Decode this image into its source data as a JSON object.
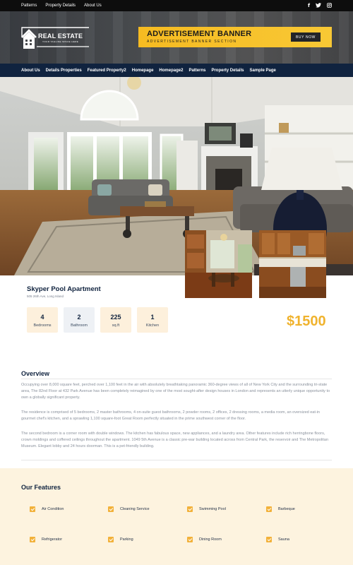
{
  "topbar": {
    "links": [
      "Patterns",
      "Property Details",
      "About Us"
    ],
    "social": [
      "facebook-icon",
      "twitter-icon",
      "instagram-icon"
    ]
  },
  "header": {
    "logo_title": "REAL ESTATE",
    "logo_tagline": "YOUR TAGLINE SPACE HERE",
    "ad_title": "ADVERTISEMENT BANNER",
    "ad_subtitle": "ADVERTISEMENT BANNER SECTION",
    "ad_button": "BUY NOW"
  },
  "nav": {
    "items": [
      "About Us",
      "Details Properties",
      "Featured Property2",
      "Homepage",
      "Homepage2",
      "Patterns",
      "Property Details",
      "Sample Page"
    ]
  },
  "property": {
    "title": "Skyper Pool Apartment",
    "address": "505 26th Ave, Long Island",
    "stats": [
      {
        "value": "4",
        "label": "Bedrooms"
      },
      {
        "value": "2",
        "label": "Bathroom"
      },
      {
        "value": "225",
        "label": "sq.ft"
      },
      {
        "value": "1",
        "label": "Kitchen"
      }
    ],
    "price": "$1500"
  },
  "overview": {
    "heading": "Overview",
    "paragraphs": [
      "Occupying over 8,000 square feet, perched over 1,100 feet in the air with absolutely breathtaking panoramic 360-degree views of all of New York City and the surrounding tri-state area, The 82nd Floor at 432 Park Avenue has been completely reimagined by one of the most sought-after design houses in London and represents an utterly unique opportunity to own a globally significant property.",
      "The residence is comprised of 5 bedrooms, 2 master bathrooms, 4 on-suite guest bathrooms, 2 powder rooms, 2 offices, 2 dressing rooms, a media room, an oversized eat-in gourmet chef's kitchen, and a sprawling 1,100 square-foot Great Room perfectly situated in the prime southwest corner of the floor.",
      "The second bedroom is a corner room with double windows. The kitchen has fabulous space, new appliances, and a laundry area. Other features include rich herringbone floors, crown moldings and coffered ceilings throughout the apartment. 1049 5th Avenue is a classic pre-war building located across from Central Park, the reservoir and The Metropolitan Museum. Elegant lobby and 24 hours doorman. This is a pet-friendly building."
    ]
  },
  "features": {
    "heading": "Our Features",
    "items": [
      "Air Condition",
      "Cleaning Service",
      "Swimming Pool",
      "Barbeque",
      "Refrigerator",
      "Parking",
      "Dining Room",
      "Sauna"
    ]
  },
  "colors": {
    "navy": "#10233f",
    "accent": "#f0b32e",
    "features_bg": "#fdf3df",
    "stat_bg_1": "#fdf0dc",
    "stat_bg_2": "#eef1f5"
  }
}
